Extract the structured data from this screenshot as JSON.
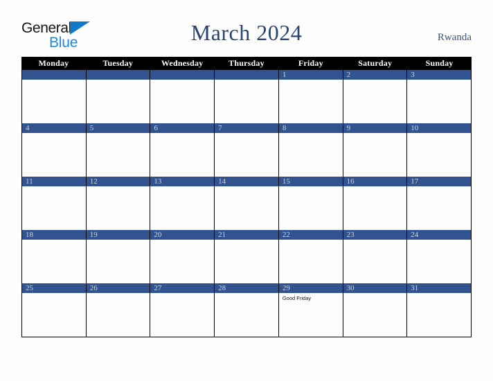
{
  "brand": {
    "name_part1": "General",
    "name_part2": "Blue",
    "triangle_color": "#1279c6",
    "part1_color": "#161616",
    "part2_color": "#1c8ad8"
  },
  "header": {
    "title": "March 2024",
    "country": "Rwanda",
    "title_color": "#2b4570",
    "country_color": "#3c5580"
  },
  "calendar": {
    "weekday_header_bg": "#000000",
    "weekday_header_color": "#ffffff",
    "date_bar_color": "#31538f",
    "date_number_color": "#cfd6e3",
    "grid_line_color": "#000000",
    "cell_bg": "#fdfdfd",
    "weekdays": [
      "Monday",
      "Tuesday",
      "Wednesday",
      "Thursday",
      "Friday",
      "Saturday",
      "Sunday"
    ],
    "weeks": [
      [
        {
          "date": "",
          "events": []
        },
        {
          "date": "",
          "events": []
        },
        {
          "date": "",
          "events": []
        },
        {
          "date": "",
          "events": []
        },
        {
          "date": "1",
          "events": []
        },
        {
          "date": "2",
          "events": []
        },
        {
          "date": "3",
          "events": []
        }
      ],
      [
        {
          "date": "4",
          "events": []
        },
        {
          "date": "5",
          "events": []
        },
        {
          "date": "6",
          "events": []
        },
        {
          "date": "7",
          "events": []
        },
        {
          "date": "8",
          "events": []
        },
        {
          "date": "9",
          "events": []
        },
        {
          "date": "10",
          "events": []
        }
      ],
      [
        {
          "date": "11",
          "events": []
        },
        {
          "date": "12",
          "events": []
        },
        {
          "date": "13",
          "events": []
        },
        {
          "date": "14",
          "events": []
        },
        {
          "date": "15",
          "events": []
        },
        {
          "date": "16",
          "events": []
        },
        {
          "date": "17",
          "events": []
        }
      ],
      [
        {
          "date": "18",
          "events": []
        },
        {
          "date": "19",
          "events": []
        },
        {
          "date": "20",
          "events": []
        },
        {
          "date": "21",
          "events": []
        },
        {
          "date": "22",
          "events": []
        },
        {
          "date": "23",
          "events": []
        },
        {
          "date": "24",
          "events": []
        }
      ],
      [
        {
          "date": "25",
          "events": []
        },
        {
          "date": "26",
          "events": []
        },
        {
          "date": "27",
          "events": []
        },
        {
          "date": "28",
          "events": []
        },
        {
          "date": "29",
          "events": [
            "Good Friday"
          ]
        },
        {
          "date": "30",
          "events": []
        },
        {
          "date": "31",
          "events": []
        }
      ]
    ]
  }
}
